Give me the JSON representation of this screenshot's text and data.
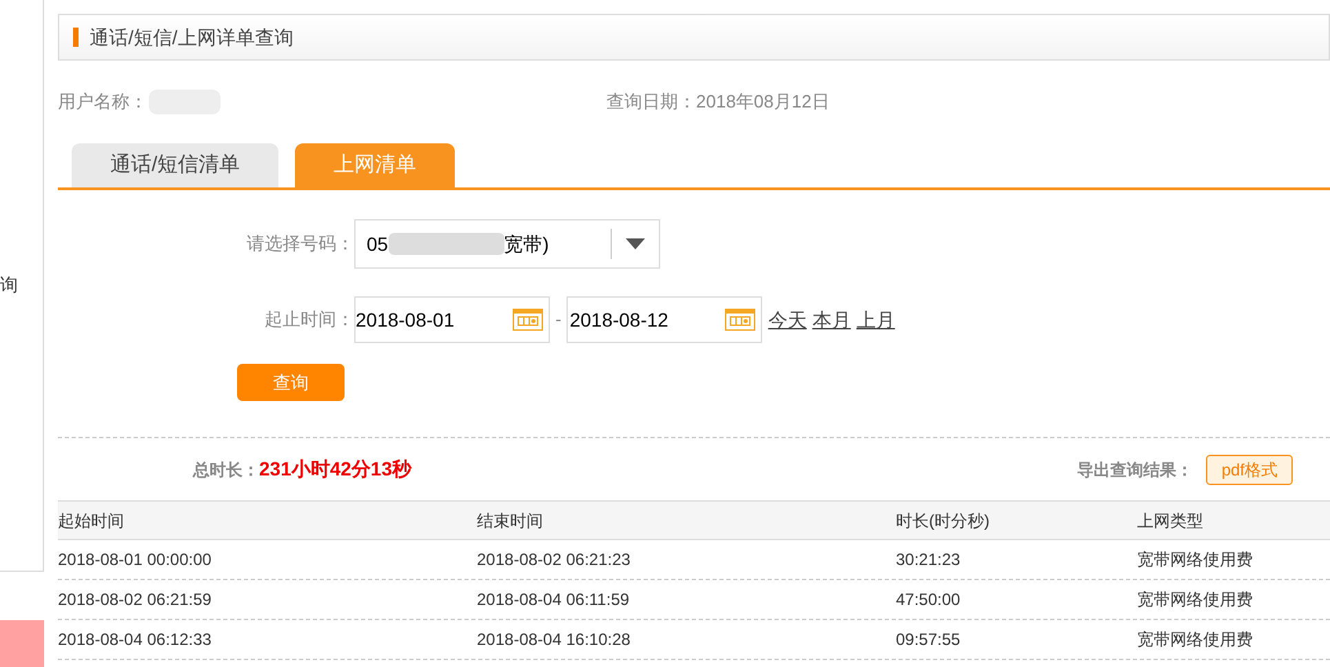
{
  "sidebar": {
    "partial_text": "询"
  },
  "header": {
    "title": "通话/短信/上网详单查询"
  },
  "info": {
    "user_label": "用户名称：",
    "query_date": "查询日期：2018年08月12日"
  },
  "tabs": [
    {
      "label": "通话/短信清单",
      "selected": false
    },
    {
      "label": "上网清单",
      "selected": true
    }
  ],
  "form": {
    "number_label": "请选择号码：",
    "number_value_start": "05",
    "number_value_end": "宽带)",
    "time_label": "起止时间：",
    "start_date": "2018-08-01",
    "end_date": "2018-08-12",
    "separator": "-",
    "quick_links": [
      "今天",
      "本月",
      "上月"
    ],
    "query_button": "查询"
  },
  "summary": {
    "total_label": "总时长：",
    "total_value": "231小时42分13秒",
    "export_label": "导出查询结果：",
    "export_button": "pdf格式"
  },
  "table": {
    "columns": [
      "起始时间",
      "结束时间",
      "时长(时分秒)",
      "上网类型"
    ],
    "rows": [
      [
        "2018-08-01 00:00:00",
        "2018-08-02 06:21:23",
        "30:21:23",
        "宽带网络使用费"
      ],
      [
        "2018-08-02 06:21:59",
        "2018-08-04 06:11:59",
        "47:50:00",
        "宽带网络使用费"
      ],
      [
        "2018-08-04 06:12:33",
        "2018-08-04 16:10:28",
        "09:57:55",
        "宽带网络使用费"
      ]
    ]
  }
}
